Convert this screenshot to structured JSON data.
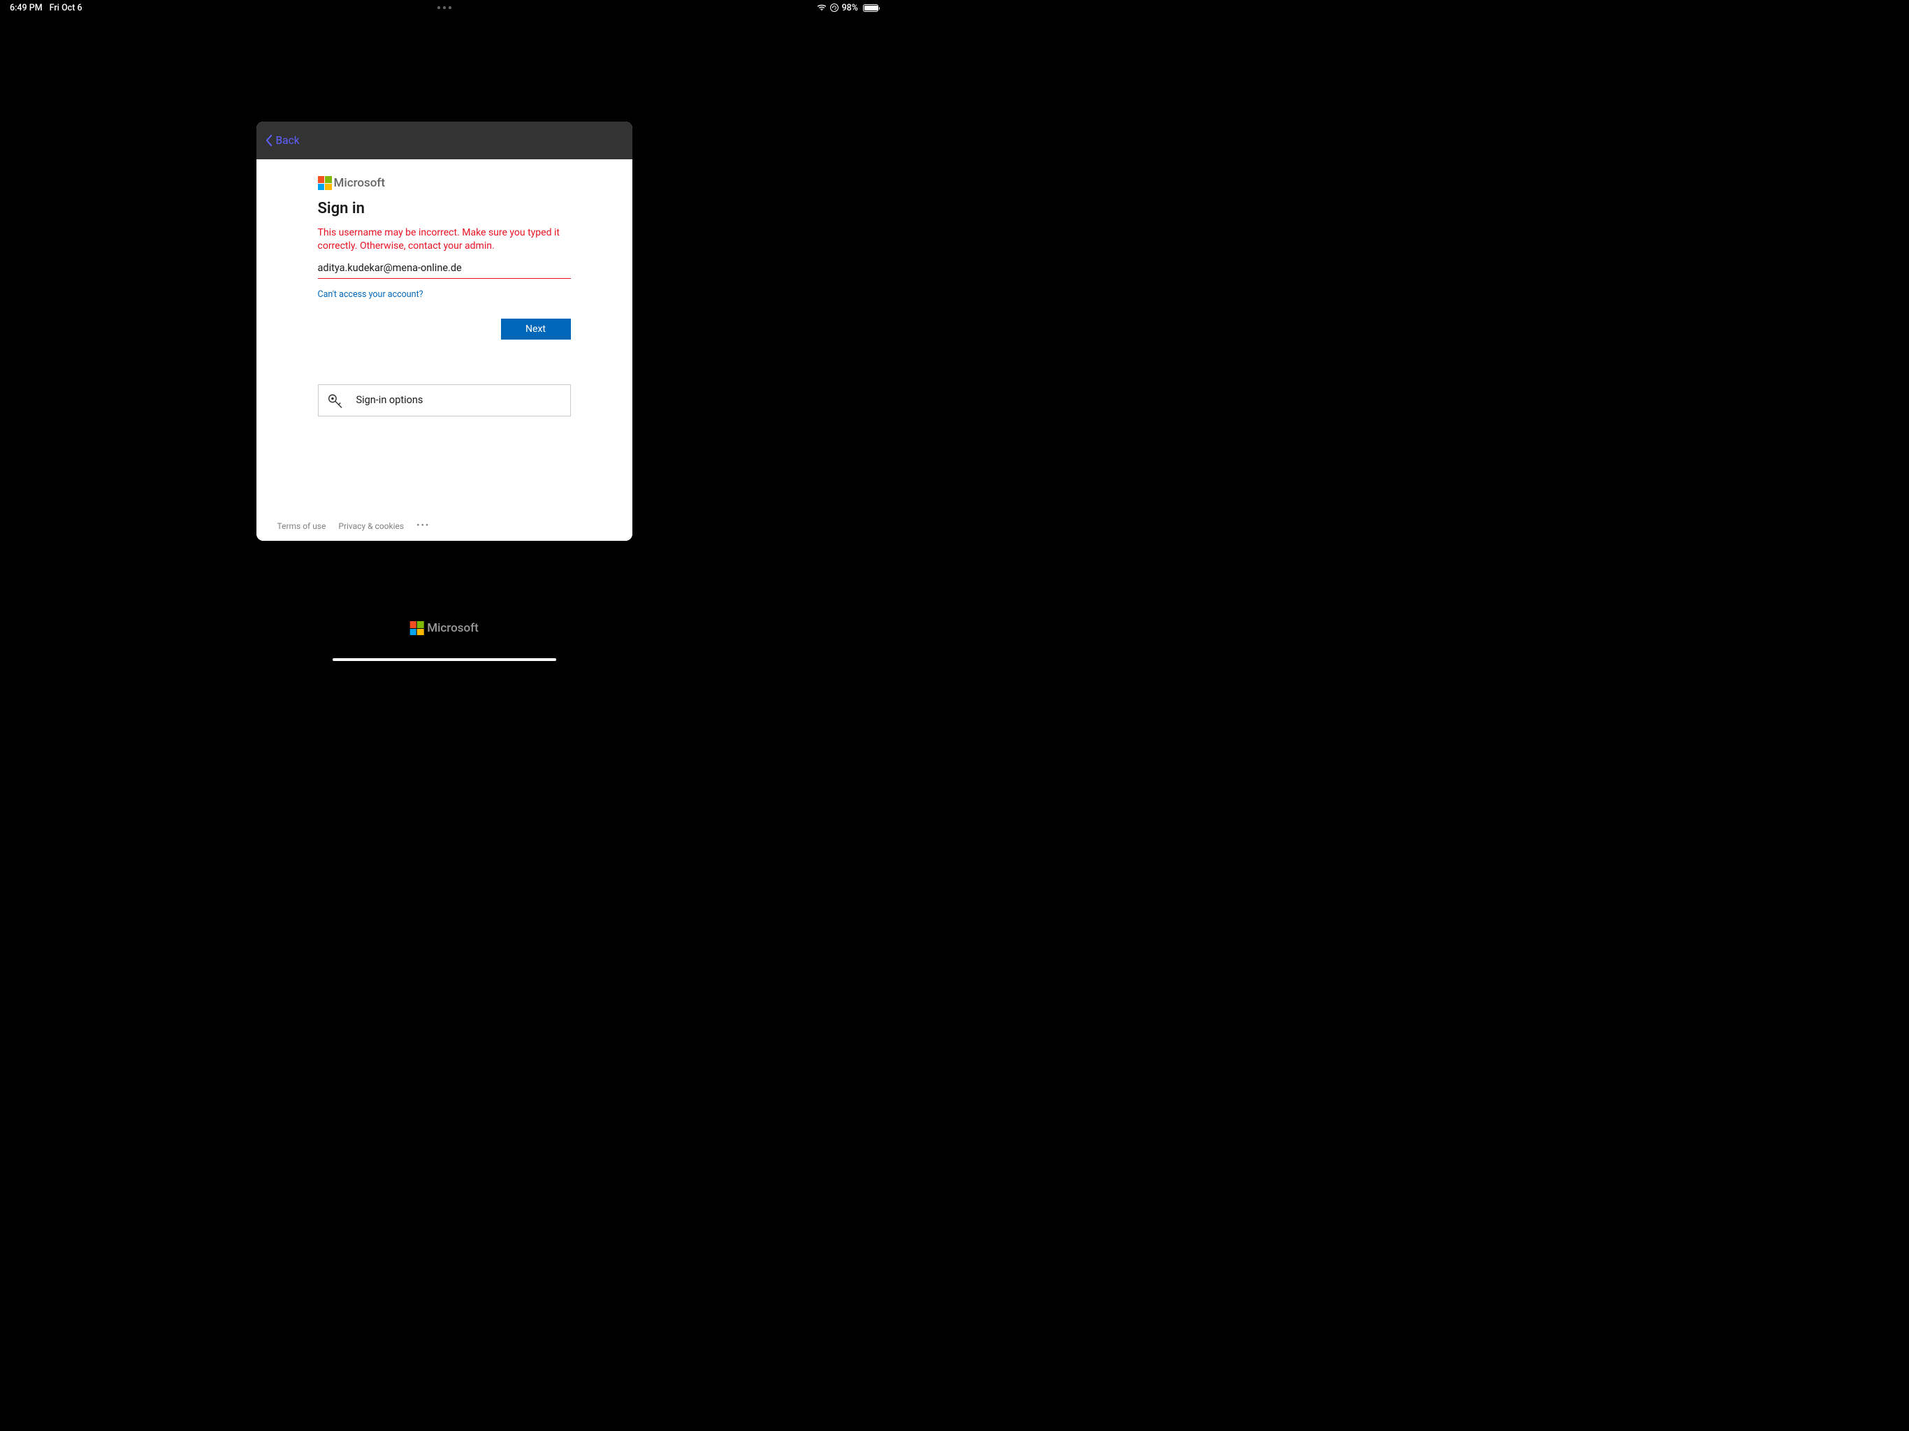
{
  "status": {
    "time": "6:49 PM",
    "date": "Fri Oct 6",
    "battery": "98%"
  },
  "modal": {
    "back_label": "Back",
    "brand": "Microsoft",
    "title": "Sign in",
    "error": "This username may be incorrect. Make sure you typed it correctly. Otherwise, contact your admin.",
    "email_value": "aditya.kudekar@mena-online.de",
    "cant_access": "Can't access your account?",
    "next_label": "Next",
    "signin_options": "Sign-in options",
    "footer": {
      "terms": "Terms of use",
      "privacy": "Privacy & cookies"
    }
  },
  "bottom_brand": "Microsoft"
}
